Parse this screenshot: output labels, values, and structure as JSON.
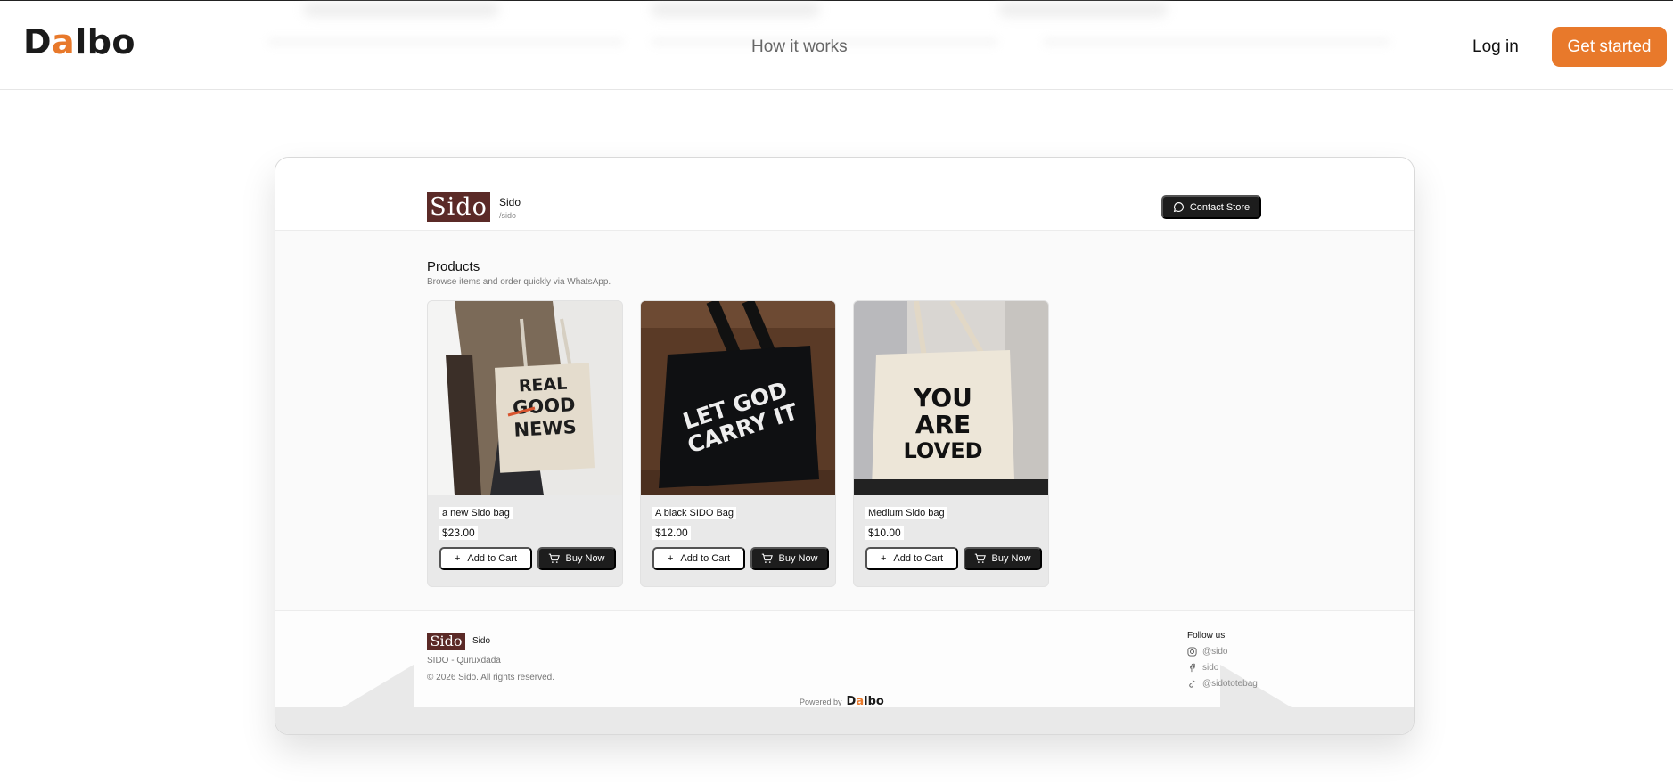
{
  "nav": {
    "logo_text": "Dalbo",
    "how_it_works": "How it works",
    "login": "Log in",
    "get_started": "Get started",
    "accent_color": "#e8792b"
  },
  "store": {
    "brand_mark": "Sido",
    "name": "Sido",
    "slug": "/sido",
    "contact_label": "Contact Store",
    "products_title": "Products",
    "products_subtitle": "Browse items and order quickly via WhatsApp.",
    "products": [
      {
        "name": "a new Sido bag",
        "price": "$23.00",
        "add_label": "Add to Cart",
        "buy_label": "Buy Now",
        "image_text": "REAL GOOD NEWS"
      },
      {
        "name": "A black SIDO Bag",
        "price": "$12.00",
        "add_label": "Add to Cart",
        "buy_label": "Buy Now",
        "image_text": "LET GOD CARRY IT"
      },
      {
        "name": "Medium Sido bag",
        "price": "$10.00",
        "add_label": "Add to Cart",
        "buy_label": "Buy Now",
        "image_text": "YOU ARE LOVED"
      }
    ]
  },
  "footer": {
    "brand_mark": "Sido",
    "name": "Sido",
    "tagline": "SIDO - Quruxdada",
    "copyright": "© 2026 Sido. All rights reserved.",
    "powered_by": "Powered by",
    "powered_logo": "Dalbo",
    "follow_title": "Follow us",
    "socials": [
      {
        "icon": "instagram-icon",
        "handle": "@sido"
      },
      {
        "icon": "facebook-icon",
        "handle": "sido"
      },
      {
        "icon": "tiktok-icon",
        "handle": "@sidototebag"
      }
    ]
  }
}
